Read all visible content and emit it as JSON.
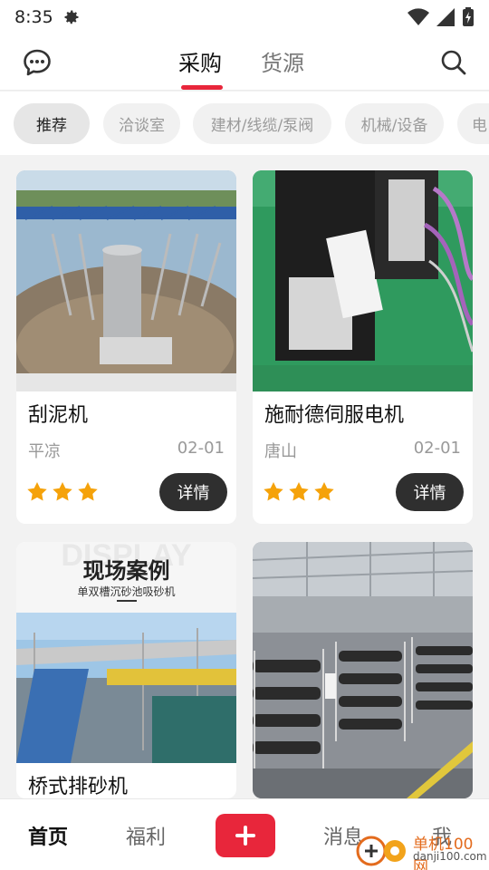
{
  "status_bar": {
    "time": "8:35"
  },
  "header": {
    "tabs": [
      {
        "label": "采购",
        "active": true
      },
      {
        "label": "货源",
        "active": false
      }
    ]
  },
  "categories": [
    {
      "label": "推荐",
      "active": true
    },
    {
      "label": "洽谈室",
      "active": false
    },
    {
      "label": "建材/线缆/泵阀",
      "active": false
    },
    {
      "label": "机械/设备",
      "active": false
    },
    {
      "label": "电",
      "active": false
    }
  ],
  "products": [
    {
      "title": "刮泥机",
      "city": "平凉",
      "date": "02-01",
      "rating": 3,
      "detail_label": "详情"
    },
    {
      "title": "施耐德伺服电机",
      "city": "唐山",
      "date": "02-01",
      "rating": 3,
      "detail_label": "详情"
    },
    {
      "title": "桥式排砂机",
      "image_heading": "现场案例",
      "image_subheading": "单双槽沉砂池吸砂机",
      "image_watermark": "DISPLAY"
    },
    {
      "title": ""
    }
  ],
  "bottom_nav": [
    {
      "label": "首页",
      "active": true
    },
    {
      "label": "福利",
      "active": false
    },
    {
      "label": "消息",
      "active": false
    },
    {
      "label": "我",
      "active": false
    }
  ],
  "watermark": {
    "text": "单机100网",
    "sub": "danji100.com"
  },
  "colors": {
    "accent": "#e8263b",
    "star": "#f5a20a",
    "button_dark": "#2f2f2f"
  }
}
